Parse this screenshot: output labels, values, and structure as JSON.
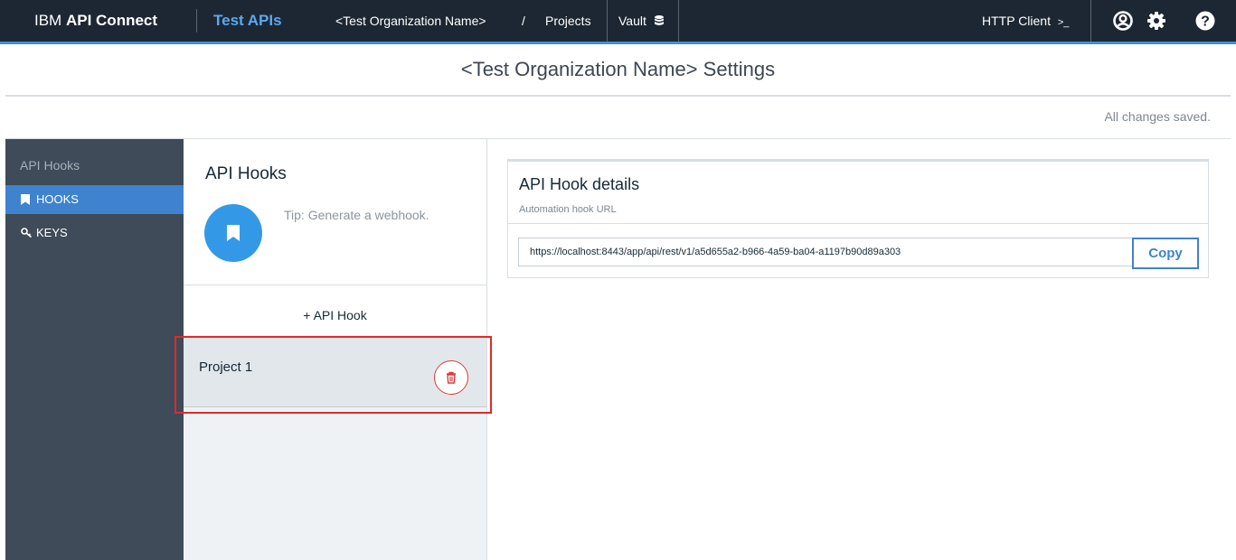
{
  "header": {
    "brand_prefix": "IBM",
    "brand_product": "API Connect",
    "app_name": "Test APIs",
    "breadcrumb_org": "<Test Organization Name>",
    "breadcrumb_sep": "/",
    "breadcrumb_projects": "Projects",
    "vault_label": "Vault",
    "http_client_label": "HTTP Client",
    "http_client_icon": "terminal-prompt-icon",
    "icons": [
      "user-icon",
      "settings-gear-icon",
      "help-icon"
    ],
    "accent_color": "#3d8fe0",
    "background_color": "#1d2733"
  },
  "page": {
    "title": "<Test Organization Name> Settings",
    "save_status": "All changes saved."
  },
  "sidebar": {
    "heading": "API Hooks",
    "items": [
      {
        "label": "HOOKS",
        "icon": "bookmark-icon",
        "active": true
      },
      {
        "label": "KEYS",
        "icon": "key-icon",
        "active": false
      }
    ]
  },
  "hooks_panel": {
    "title": "API Hooks",
    "tip": "Tip: Generate a webhook.",
    "add_label": "+ API Hook",
    "hooks": [
      {
        "name": "Project 1",
        "selected": true
      }
    ],
    "delete_color": "#e03b3b"
  },
  "details": {
    "title": "API Hook details",
    "subtitle": "Automation hook URL",
    "url": "https://localhost:8443/app/api/rest/v1/a5d655a2-b966-4a59-ba04-a1197b90d89a303",
    "copy_label": "Copy"
  }
}
